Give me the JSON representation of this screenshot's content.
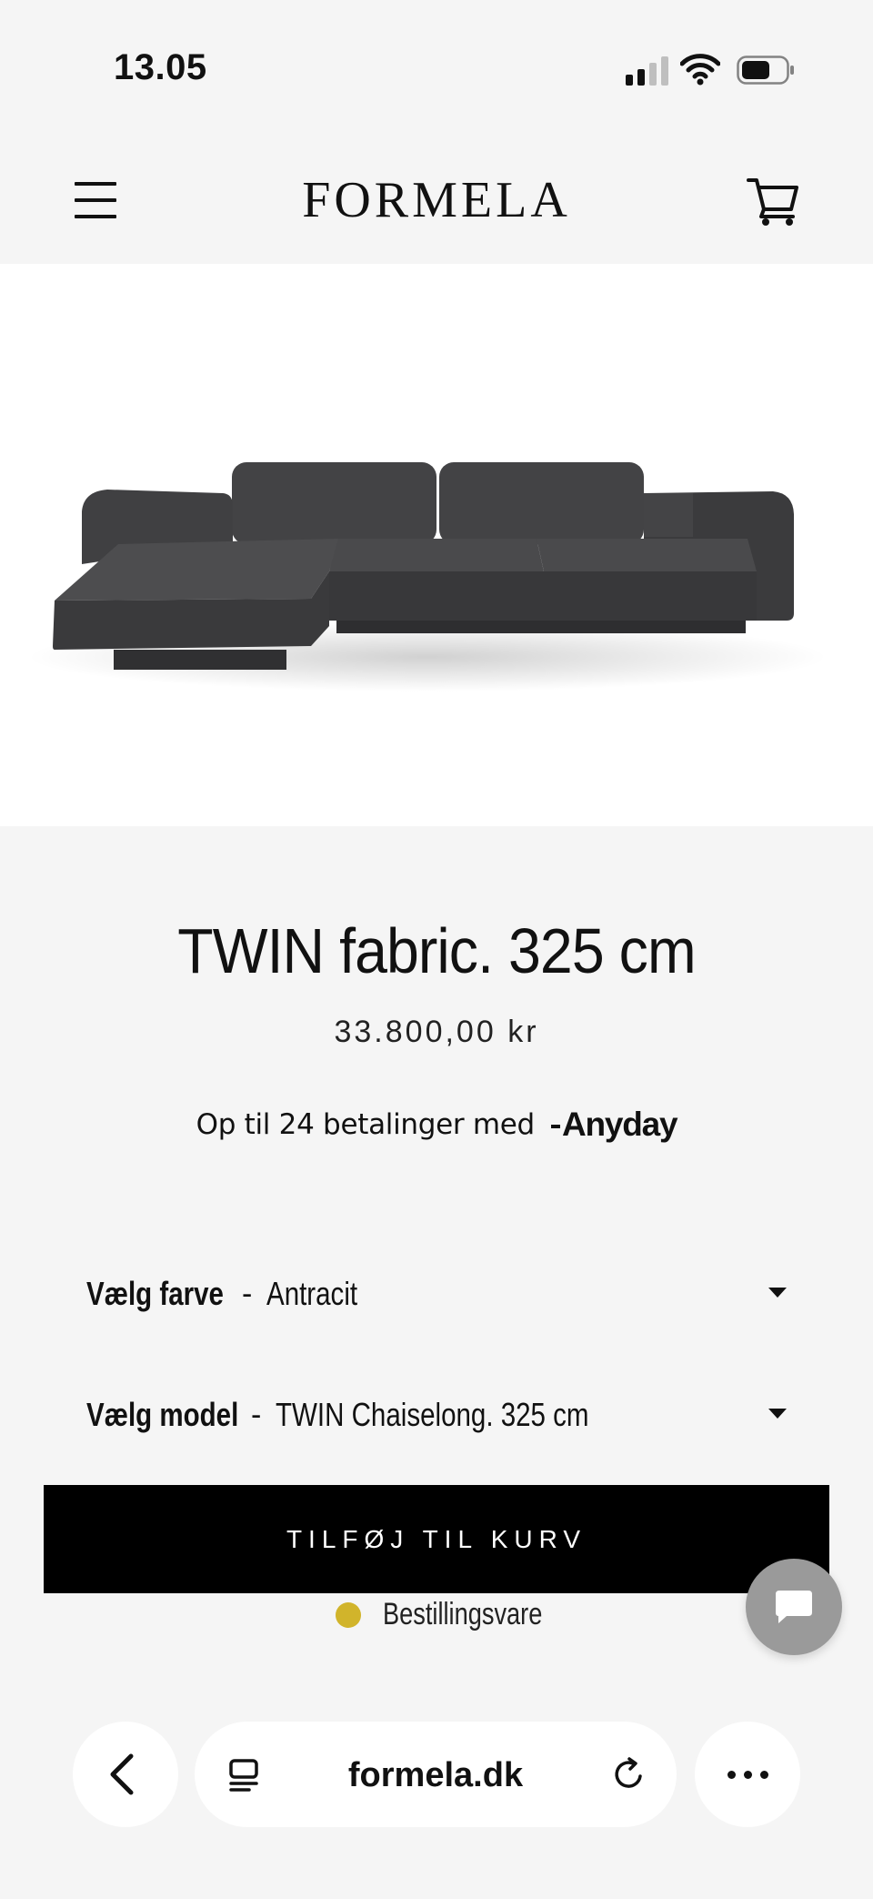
{
  "status_bar": {
    "time": "13.05",
    "icons": [
      "cellular-signal-icon",
      "wifi-icon",
      "battery-icon"
    ]
  },
  "header": {
    "logo": "FORMELA",
    "icons": [
      "hamburger-menu-icon",
      "shopping-cart-icon"
    ]
  },
  "product": {
    "image_alt": "Dark grey fabric sofa with chaise longue",
    "sofa_color": "#3d3d3f",
    "title": "TWIN fabric. 325 cm",
    "price": "33.800,00 kr",
    "installments_text": "Op til 24 betalinger med",
    "installments_brand": "Anyday"
  },
  "options": {
    "color": {
      "label": "Vælg farve",
      "separator": "-",
      "value": "Antracit"
    },
    "model": {
      "label": "Vælg model",
      "separator": "-",
      "value": "TWIN Chaiselong. 325 cm"
    }
  },
  "actions": {
    "add_to_cart_label": "TILFØJ TIL KURV"
  },
  "stock": {
    "status_text": "Bestillingsvare",
    "indicator_color": "#d1b42b"
  },
  "chat": {
    "icon": "chat-bubble-icon"
  },
  "browser": {
    "url": "formela.dk",
    "icons": [
      "back-chevron-icon",
      "reader-mode-icon",
      "reload-icon",
      "more-dots-icon"
    ]
  },
  "colors": {
    "background": "#f5f5f5",
    "image_background": "#ffffff",
    "button_background": "#000000",
    "chat_button": "#9a9a9a"
  }
}
